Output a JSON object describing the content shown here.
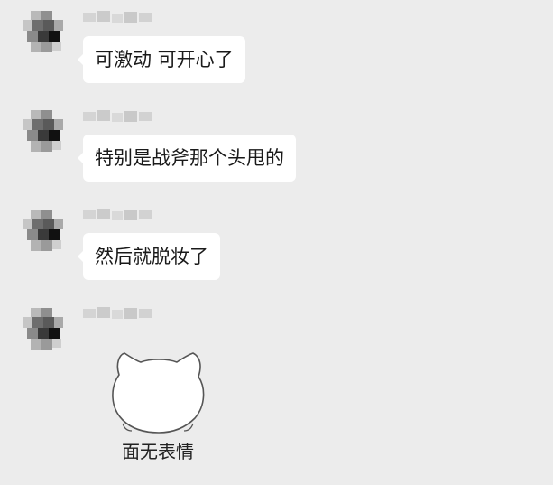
{
  "chat": {
    "messages": [
      {
        "type": "text",
        "text": "可激动 可开心了"
      },
      {
        "type": "text",
        "text": "特别是战斧那个头甩的"
      },
      {
        "type": "text",
        "text": "然后就脱妆了"
      },
      {
        "type": "sticker",
        "sticker_icon": "round-cat-face-icon",
        "caption": "面无表情"
      }
    ]
  },
  "colors": {
    "background": "#ececec",
    "bubble": "#ffffff",
    "text": "#1a1a1a"
  }
}
